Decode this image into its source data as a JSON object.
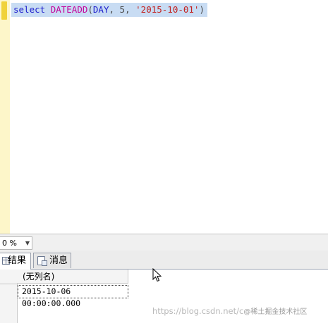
{
  "editor": {
    "query_tokens": {
      "keyword": "select",
      "function": "DATEADD",
      "open_paren": "(",
      "unit": "DAY",
      "sep1": ", ",
      "number": "5",
      "sep2": ", ",
      "string_literal": "'2015-10-01'",
      "close_paren": ")"
    },
    "colors": {
      "keyword": "#1d1dcc",
      "function": "#c4009a",
      "string": "#c2211f",
      "selection": "#c8dcf3"
    }
  },
  "zoom": {
    "value": "0 %"
  },
  "tabs": [
    {
      "label": "结果",
      "icon": "grid-icon",
      "active": true
    },
    {
      "label": "消息",
      "icon": "messages-icon",
      "active": false
    }
  ],
  "results": {
    "columns": [
      "(无列名)"
    ],
    "rows": [
      [
        "2015-10-06 00:00:00.000"
      ]
    ]
  },
  "watermark": {
    "text": "https://blog.csdn.net/c",
    "badge": "@稀土掘金技术社区"
  }
}
